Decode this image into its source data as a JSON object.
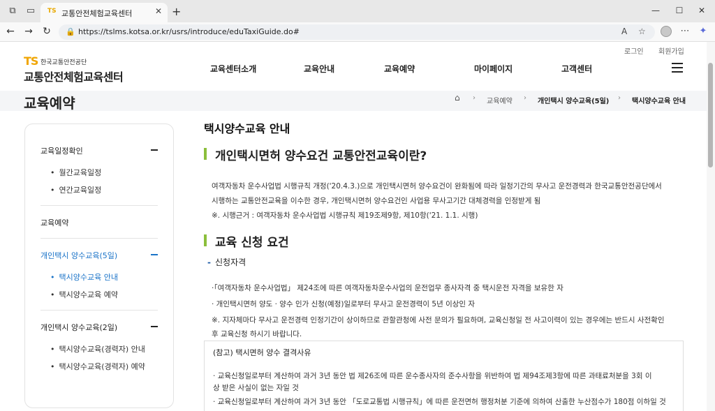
{
  "browser": {
    "tab_title": "교통안전체험교육센터",
    "tab_favicon": "TS",
    "url": "https://tslms.kotsa.or.kr/usrs/introduce/eduTaxiGuide.do#",
    "read_aloud_label": "A",
    "tab_close": "✕",
    "new_tab": "+",
    "icons": {
      "workspaces": "⧉",
      "tab_actions": "▭",
      "back": "←",
      "forward": "→",
      "refresh": "↻",
      "lock": "🔒",
      "favorite": "☆",
      "favorites_bar": "✩",
      "more": "⋯",
      "copilot": "✦",
      "minimize": "—",
      "maximize": "☐",
      "close": "✕"
    }
  },
  "site": {
    "util_links": [
      "로그인",
      "회원가입"
    ],
    "logo_mark": "TS",
    "logo_org": "한국교통안전공단",
    "logo_name": "교통안전체험교육센터",
    "gnb": [
      "교육센터소개",
      "교육안내",
      "교육예약",
      "마이페이지",
      "고객센터"
    ],
    "page_title": "교육예약",
    "breadcrumb": [
      "⌂",
      "교육예약",
      "개인택시 양수교육(5일)",
      "택시양수교육 안내"
    ],
    "crumb_sep": "›"
  },
  "sidebar": {
    "groups": [
      {
        "label": "교육일정확인",
        "expanded": true,
        "active": false,
        "items": [
          {
            "label": "월간교육일정",
            "active": false
          },
          {
            "label": "연간교육일정",
            "active": false
          }
        ]
      },
      {
        "label": "교육예약",
        "expanded": false,
        "active": false,
        "items": []
      },
      {
        "label": "개인택시 양수교육(5일)",
        "expanded": true,
        "active": true,
        "items": [
          {
            "label": "택시양수교육 안내",
            "active": true
          },
          {
            "label": "택시양수교육 예약",
            "active": false
          }
        ]
      },
      {
        "label": "개인택시 양수교육(2일)",
        "expanded": true,
        "active": false,
        "items": [
          {
            "label": "택시양수교육(경력자) 안내",
            "active": false
          },
          {
            "label": "택시양수교육(경력자) 예약",
            "active": false
          }
        ]
      }
    ]
  },
  "content": {
    "title": "택시양수교육 안내",
    "section1": {
      "heading": "개인택시면허 양수요건 교통안전교육이란?",
      "lines": [
        "여객자동차 운수사업법 시행규칙 개정('20.4.3.)으로 개인택시면허 양수요건이 완화됨에 따라 일정기간의 무사고 운전경력과 한국교통안전공단에서",
        "시행하는 교통안전교육을 이수한 경우, 개인택시면허 양수요건인 사업용 무사고기간 대체경력을 인정받게 됨",
        "※. 시행근거 : 여객자동차 운수사업법 시행규칙 제19조제9항, 제10항('21. 1.1. 시행)"
      ]
    },
    "section2": {
      "heading": "교육 신청 요건",
      "subheading": "신청자격",
      "subheading_marker": "-",
      "items": [
        "·「여객자동차 운수사업법」 제24조에 따른 여객자동차운수사업의 운전업무 종사자격 중 택시운전 자격을 보유한 자",
        "· 개인택시면허 양도 · 양수 인가 신청(예정)일로부터 무사고 운전경력이 5년 이상인 자",
        "※. 지자체마다 무사고 운전경력 인정기간이 상이하므로 관할관청에 사전 문의가 필요하며, 교육신청일 전 사고이력이 있는 경우에는 반드시 사전확인",
        "후 교육신청 하시기 바랍니다."
      ],
      "note": {
        "title": "(참고) 택시면허 양수 결격사유",
        "items": [
          "· 교육신청일로부터 계산하여 과거 3년 동안 법 제26조에 따른 운수종사자의 준수사항을 위반하여 법 제94조제3항에 따른 과태료처분을 3회 이",
          "  상 받은 사실이 없는 자일 것",
          "· 교육신청일로부터 계산하여 과거 3년 동안 「도로교통법 시행규칙」에 따른 운전면허 행정처분 기준에 의하여 산출한 누산점수가 180점 이하일 것"
        ]
      }
    }
  }
}
